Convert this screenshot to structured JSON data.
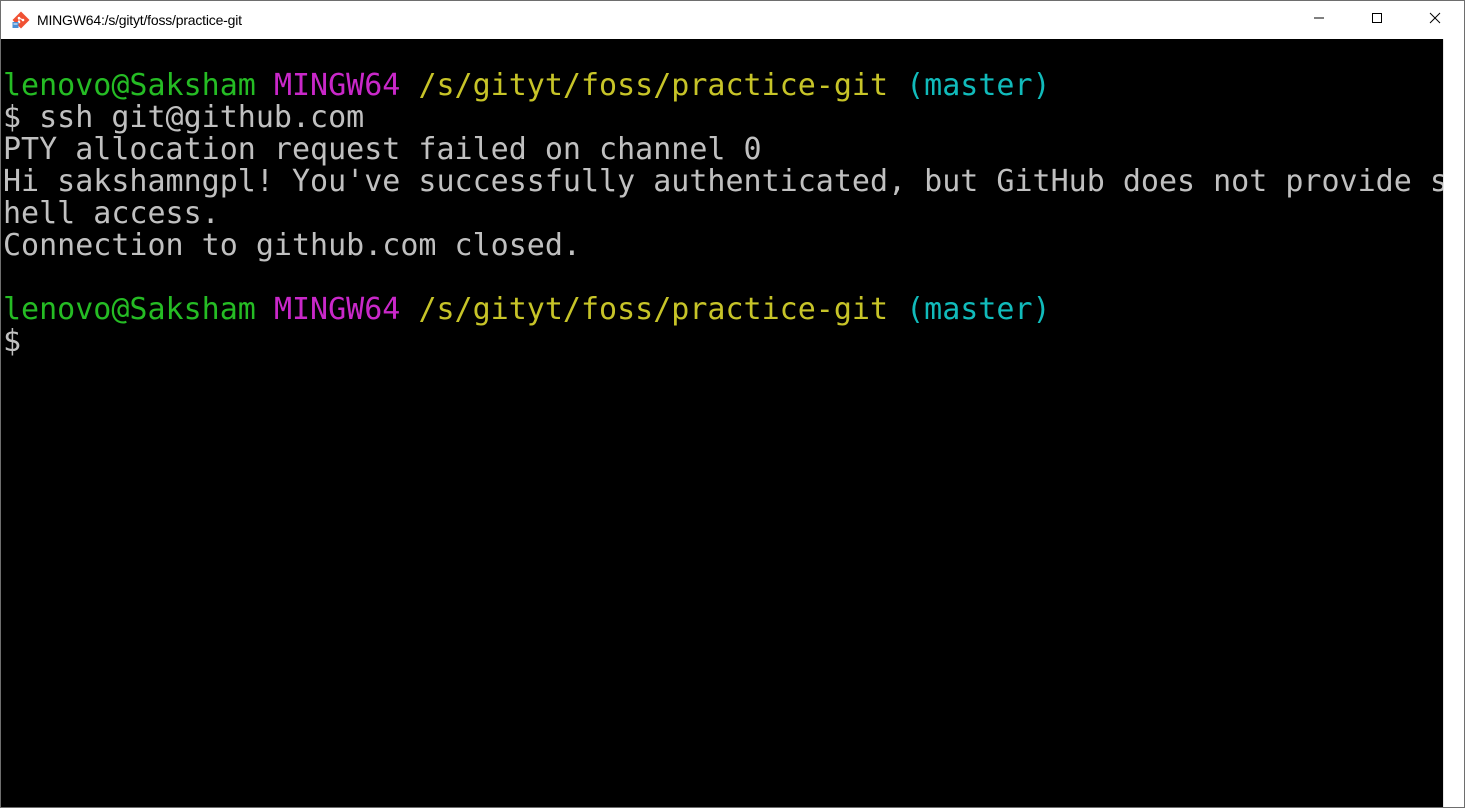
{
  "window": {
    "title": "MINGW64:/s/gityt/foss/practice-git",
    "icon": "git-bash-icon",
    "controls": [
      "minimize-icon",
      "maximize-icon",
      "close-icon"
    ]
  },
  "colors": {
    "user": "#25bc24",
    "host": "#c928c9",
    "path": "#c7c428",
    "branch": "#11bbbb",
    "text": "#c0c0c0",
    "background": "#000000"
  },
  "terminal": {
    "prompt1": {
      "user": "lenovo@Saksham",
      "host": "MINGW64",
      "path": "/s/gityt/foss/practice-git",
      "branch": "(master)"
    },
    "command1": "$ ssh git@github.com",
    "output": [
      "PTY allocation request failed on channel 0",
      "Hi sakshamngpl! You've successfully authenticated, but GitHub does not provide s",
      "hell access.",
      "Connection to github.com closed."
    ],
    "prompt2": {
      "user": "lenovo@Saksham",
      "host": "MINGW64",
      "path": "/s/gityt/foss/practice-git",
      "branch": "(master)"
    },
    "command2": "$"
  }
}
